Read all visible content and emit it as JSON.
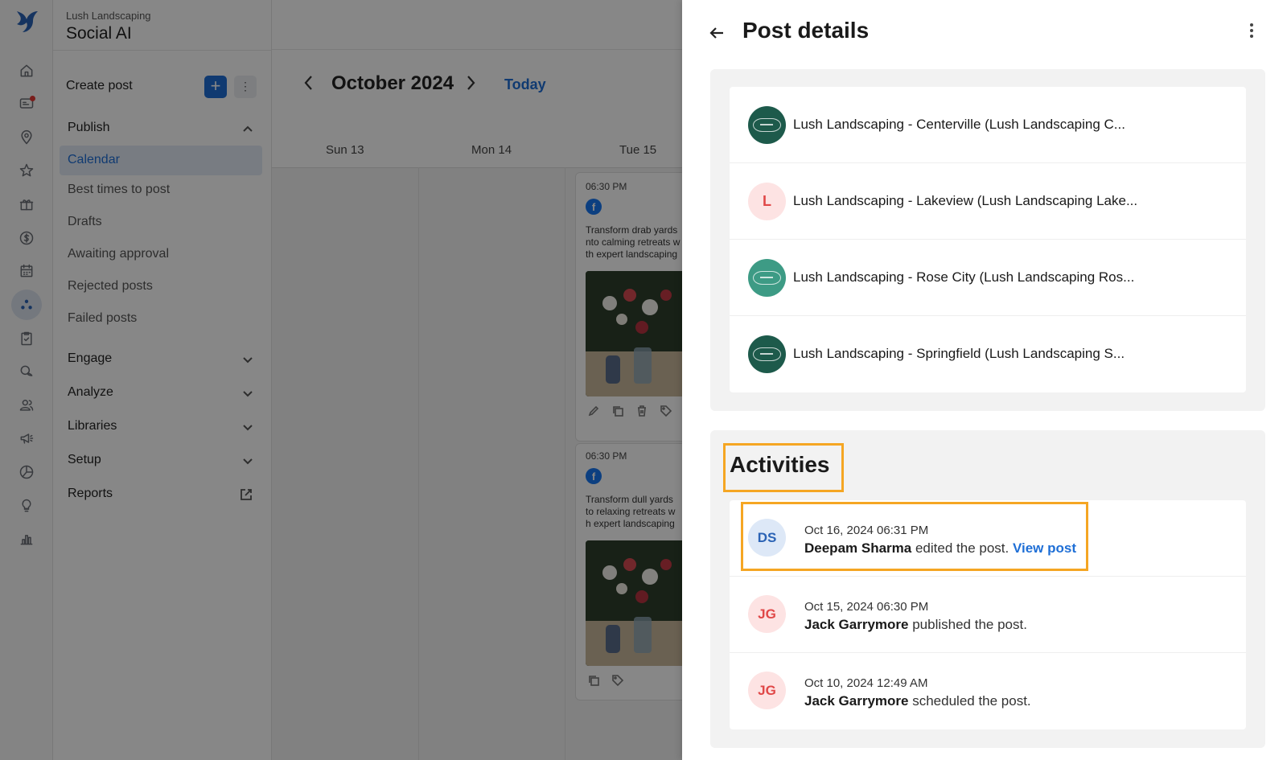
{
  "app": {
    "brand_sub": "Lush Landscaping",
    "brand_title": "Social AI",
    "logo_icon": "bird-logo-icon",
    "accent_color": "#1f6fd6"
  },
  "rail": {
    "icons": [
      "home-icon",
      "messages-icon",
      "location-pin-icon",
      "star-icon",
      "gift-icon",
      "dollar-icon",
      "calendar-icon",
      "social-icon",
      "checklist-icon",
      "chat-icon",
      "users-icon",
      "megaphone-icon",
      "pie-chart-icon",
      "lightbulb-icon",
      "bar-chart-icon"
    ],
    "active": "social-icon"
  },
  "nav": {
    "create_post_label": "Create post",
    "publish_label": "Publish",
    "publish_items": [
      "Calendar",
      "Best times to post",
      "Drafts",
      "Awaiting approval",
      "Rejected posts",
      "Failed posts"
    ],
    "active_item": "Calendar",
    "sections": [
      "Engage",
      "Analyze",
      "Libraries",
      "Setup"
    ],
    "reports_label": "Reports"
  },
  "calendar": {
    "month": "October 2024",
    "today_label": "Today",
    "days": [
      "Sun 13",
      "Mon 14",
      "Tue 15"
    ],
    "posts": [
      {
        "time": "06:30 PM",
        "network": "facebook-icon",
        "text": "Transform drab yards\nnto calming retreats w\nth expert landscaping"
      },
      {
        "time": "06:30 PM",
        "network": "facebook-icon",
        "text": "Transform dull yards\nto relaxing retreats w\nh expert landscaping"
      }
    ]
  },
  "drawer": {
    "title": "Post details",
    "locations": [
      {
        "name": "Lush Landscaping - Centerville (Lush Landscaping C...",
        "avatar": "logo"
      },
      {
        "name": "Lush Landscaping - Lakeview (Lush Landscaping Lake...",
        "avatar": "L"
      },
      {
        "name": "Lush Landscaping - Rose City (Lush Landscaping Ros...",
        "avatar": "logo"
      },
      {
        "name": "Lush Landscaping - Springfield (Lush Landscaping S...",
        "avatar": "logo"
      }
    ],
    "activities_title": "Activities",
    "activities": [
      {
        "initials": "DS",
        "time": "Oct 16, 2024 06:31 PM",
        "user": "Deepam Sharma",
        "action": "edited the post.",
        "link": "View post"
      },
      {
        "initials": "JG",
        "time": "Oct 15, 2024 06:30 PM",
        "user": "Jack Garrymore",
        "action": "published the post.",
        "link": ""
      },
      {
        "initials": "JG",
        "time": "Oct 10, 2024 12:49 AM",
        "user": "Jack Garrymore",
        "action": "scheduled the post.",
        "link": ""
      }
    ],
    "highlight_color": "#f5a623"
  }
}
